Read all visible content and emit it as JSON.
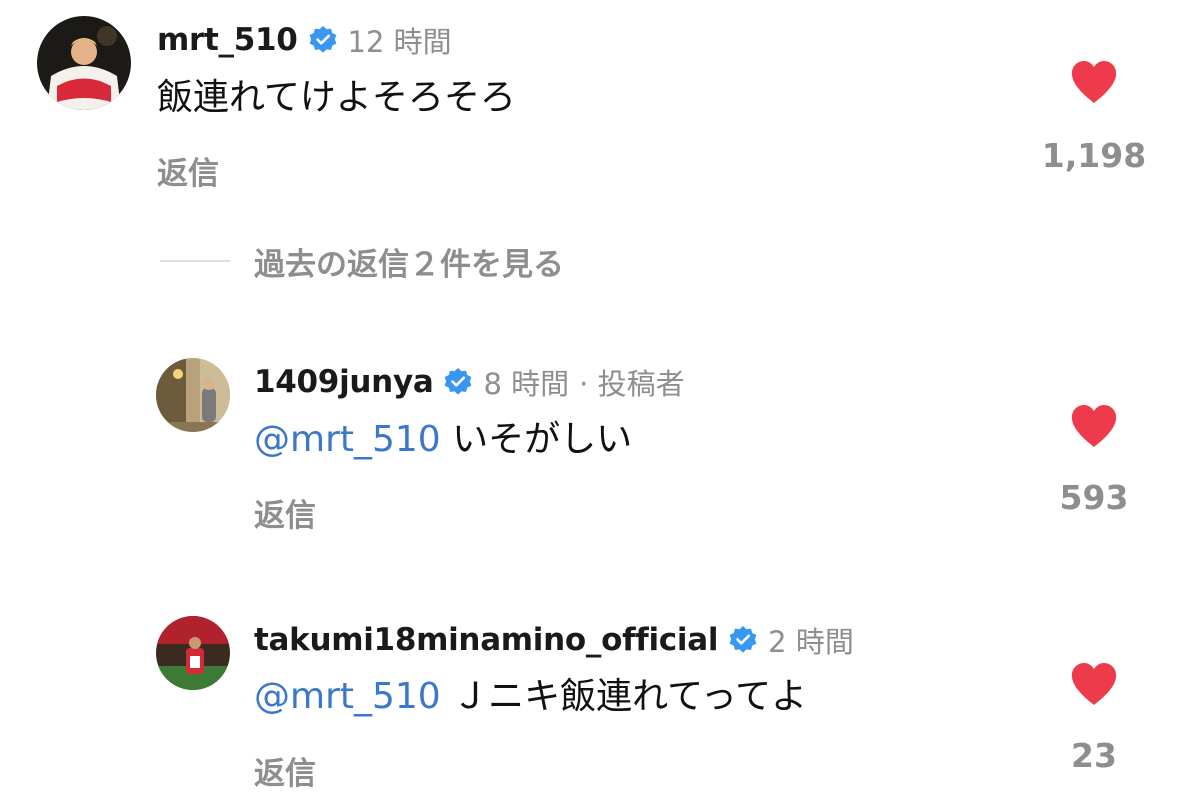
{
  "comments": [
    {
      "username": "mrt_510",
      "verified": true,
      "time": "12 時間",
      "author_tag": "",
      "mention": "",
      "text": "飯連れてけよそろそろ",
      "reply_label": "返信",
      "likes": "1,198",
      "avatar_desc": "person-with-flag"
    },
    {
      "username": "1409junya",
      "verified": true,
      "time": "8 時間",
      "author_tag": "· 投稿者",
      "mention": "@mrt_510",
      "text": "いそがしい",
      "reply_label": "返信",
      "likes": "593",
      "avatar_desc": "person-indoors"
    },
    {
      "username": "takumi18minamino_official",
      "verified": true,
      "time": "2 時間",
      "author_tag": "",
      "mention": "@mrt_510",
      "text": "Ｊニキ飯連れてってよ",
      "reply_label": "返信",
      "likes": "23",
      "avatar_desc": "player-in-stadium"
    }
  ],
  "view_replies": {
    "label": "過去の返信２件を見る"
  },
  "colors": {
    "heart": "#ed3b4b",
    "mention": "#3b78c9",
    "verified": "#3897f0",
    "secondary_text": "#8e8e8e"
  },
  "icons": {
    "like": "heart-icon",
    "verified": "verified-badge-icon"
  }
}
